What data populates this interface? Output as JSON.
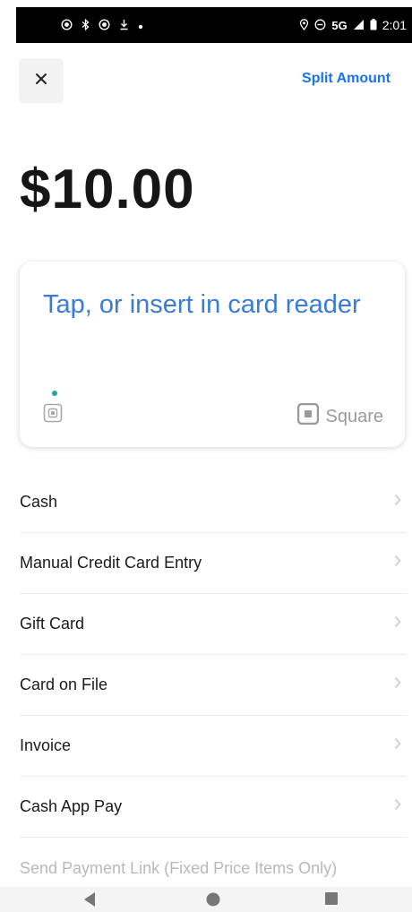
{
  "status_bar": {
    "network": "5G",
    "time": "2:01",
    "icons": [
      "target-icon",
      "bluetooth-icon",
      "target-icon",
      "download-icon",
      "dot-icon",
      "location-icon",
      "dnd-icon",
      "signal-icon",
      "battery-icon"
    ]
  },
  "header": {
    "close_icon": "close-icon",
    "split_label": "Split Amount"
  },
  "payment": {
    "amount": "$10.00"
  },
  "reader": {
    "prompt": "Tap, or insert in card reader",
    "brand_name": "Square",
    "accent_color": "#3a7bd5",
    "indicator_color": "#2aa39a"
  },
  "methods": [
    {
      "label": "Cash"
    },
    {
      "label": "Manual Credit Card Entry"
    },
    {
      "label": "Gift Card"
    },
    {
      "label": "Card on File"
    },
    {
      "label": "Invoice"
    },
    {
      "label": "Cash App Pay"
    },
    {
      "label": "Send Payment Link (Fixed Price Items Only)"
    }
  ],
  "nav": {
    "icons": [
      "back-icon",
      "home-icon",
      "recents-icon"
    ]
  }
}
